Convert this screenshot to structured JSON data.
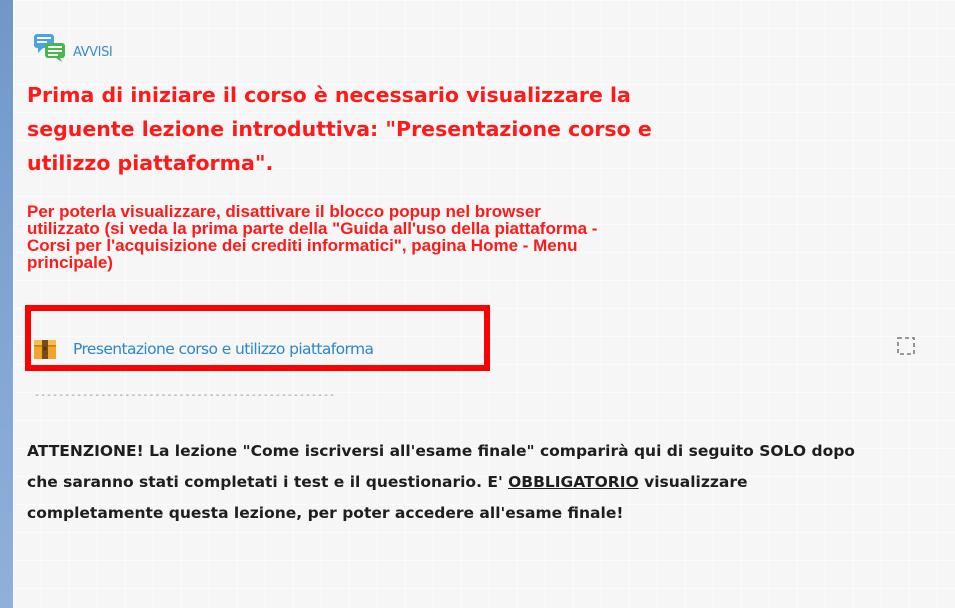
{
  "forum": {
    "icon": "forum-chat-icon",
    "label": "AVVISI"
  },
  "notice": {
    "main_text": "Prima di iniziare il corso è necessario visualizzare la\nseguente lezione introduttiva:  \"Presentazione  corso  e\n utilizzo piattaforma\".",
    "sub_text": "Per poterla visualizzare, disattivare il blocco popup nel browser\nutilizzato (si veda la prima parte della \"Guida all'uso della piattaforma -\nCorsi per l'acquisizione dei crediti informatici\", pagina Home - Menu\nprincipale)",
    "color": "#ff1a1a"
  },
  "resource": {
    "icon": "package-icon",
    "label": "Presentazione corso e utilizzo piattaforma",
    "highlight_color": "#ff0000"
  },
  "separator": "--------------------------------------------------",
  "completion": {
    "icon": "completion-checkbox-icon"
  },
  "warning": {
    "part1": "ATTENZIONE! La lezione  \"Come  iscriversi  all'esame  finale\"  comparirà qui di seguito SOLO dopo che saranno stati completati i test e il questionario. E' ",
    "underlined": "OBBLIGATORIO",
    "part2": " visualizzare completamente questa lezione, per poter accedere all'esame finale!"
  }
}
